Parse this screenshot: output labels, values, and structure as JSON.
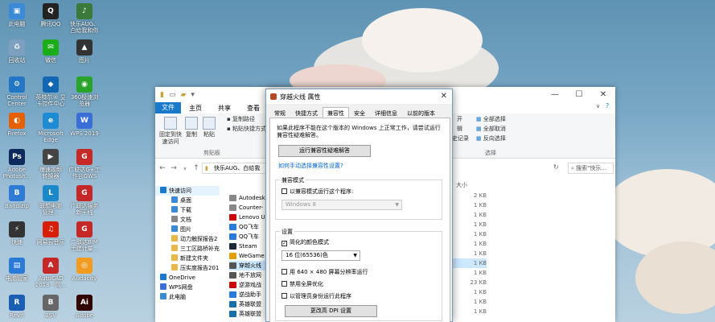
{
  "desktop": {
    "icons": [
      {
        "label": "此电脑",
        "color": "#3a8ad8",
        "glyph": "▣"
      },
      {
        "label": "腾讯QQ",
        "color": "#222",
        "glyph": "Q"
      },
      {
        "label": "快乐AUG、\n白给我和你",
        "color": "#3b7a3b",
        "glyph": "♪"
      },
      {
        "label": "回收站",
        "color": "#7da0c0",
        "glyph": "♻"
      },
      {
        "label": "微信",
        "color": "#1aad19",
        "glyph": "✉"
      },
      {
        "label": "图片",
        "color": "#333",
        "glyph": "▲"
      },
      {
        "label": "Control\nCenter",
        "color": "#2376c4",
        "glyph": "⚙"
      },
      {
        "label": "英特尔® 显\n卡控件中心",
        "color": "#1167b1",
        "glyph": "◆"
      },
      {
        "label": "360极速浏\n览器",
        "color": "#29a329",
        "glyph": "◉"
      },
      {
        "label": "Firefox",
        "color": "#e66000",
        "glyph": "◐"
      },
      {
        "label": "Microsoft\nEdge",
        "color": "#1e8bd3",
        "glyph": "e"
      },
      {
        "label": "WPS 2019",
        "color": "#3b6fd8",
        "glyph": "W"
      },
      {
        "label": "Adobe\nPhotosh...",
        "color": "#0e2a5c",
        "glyph": "Ps"
      },
      {
        "label": "爆速视频\n转换器",
        "color": "#444",
        "glyph": "▶"
      },
      {
        "label": "广联达G+工\n作台GWS",
        "color": "#c62828",
        "glyph": "G"
      },
      {
        "label": "Bandizip",
        "color": "#2d7bd4",
        "glyph": "B"
      },
      {
        "label": "联想电脑\n管理...",
        "color": "#1a88c9",
        "glyph": "L"
      },
      {
        "label": "广联达服务\n新干线",
        "color": "#c62828",
        "glyph": "G"
      },
      {
        "label": "快速",
        "color": "#333",
        "glyph": "⚡"
      },
      {
        "label": "网易云音乐",
        "color": "#d81e06",
        "glyph": "♫"
      },
      {
        "label": "广联达BIM\n土建计量...",
        "color": "#c62828",
        "glyph": "G"
      },
      {
        "label": "电脑管家",
        "color": "#2a7ad8",
        "glyph": "▤"
      },
      {
        "label": "AutoCAD\n2018 - 简...",
        "color": "#c62828",
        "glyph": "A"
      },
      {
        "label": "Audacity",
        "color": "#f29c1f",
        "glyph": "◎"
      },
      {
        "label": "Revit",
        "color": "#1a5fb4",
        "glyph": "R"
      },
      {
        "label": "BSV",
        "color": "#666",
        "glyph": "B"
      },
      {
        "label": "Adobe",
        "color": "#300",
        "glyph": "Ai"
      }
    ]
  },
  "explorer": {
    "title": "",
    "window_controls": [
      "—",
      "☐",
      "✕"
    ],
    "menu_tabs": [
      "文件",
      "主页",
      "共享",
      "查看"
    ],
    "ribbon": {
      "pin_label": "固定到快\n速访问",
      "copy_label": "复制",
      "paste_label": "粘贴",
      "copy_path": "复制路径",
      "paste_shortcut": "粘贴快捷方式",
      "cut": "剪切",
      "clipboard_group": "剪贴板",
      "select_all": "全部选择",
      "select_none": "全部取消",
      "invert": "反向选择",
      "select_group": "选择",
      "open_label": "开",
      "edit_label": "辑",
      "history_label": "历史记录",
      "help_label": "?"
    },
    "address": {
      "path": "快乐AUG、白给我",
      "search_placeholder": "搜索\"快乐...",
      "nav": [
        "←",
        "→",
        "∨",
        "↑"
      ]
    },
    "nav_pane": [
      {
        "label": "快速访问",
        "color": "#1979ca"
      },
      {
        "label": "桌面",
        "color": "#3a8ad8"
      },
      {
        "label": "下载",
        "color": "#3a8ad8"
      },
      {
        "label": "文档",
        "color": "#888"
      },
      {
        "label": "图片",
        "color": "#3a8ad8"
      },
      {
        "label": "动力触探报告2",
        "color": "#e8b84a"
      },
      {
        "label": "三工区路桥补充",
        "color": "#e8b84a"
      },
      {
        "label": "新建文件夹",
        "color": "#e8b84a"
      },
      {
        "label": "压实度报告201",
        "color": "#e8b84a"
      },
      {
        "label": "OneDrive",
        "color": "#1979ca"
      },
      {
        "label": "WPS网盘",
        "color": "#3b6fd8"
      },
      {
        "label": "此电脑",
        "color": "#3a8ad8"
      }
    ],
    "files": [
      {
        "label": "Autodesk",
        "color": "#888"
      },
      {
        "label": "Counter-",
        "color": "#888"
      },
      {
        "label": "Lenovo U",
        "color": "#c00"
      },
      {
        "label": "QQ飞车",
        "color": "#2a7ad8"
      },
      {
        "label": "QQ飞车",
        "color": "#2a7ad8"
      },
      {
        "label": "Steam",
        "color": "#1b2838"
      },
      {
        "label": "WeGame",
        "color": "#e0a000"
      },
      {
        "label": "穿越火线",
        "color": "#555"
      },
      {
        "label": "地不放网",
        "color": "#555"
      },
      {
        "label": "逆游戏战",
        "color": "#c00"
      },
      {
        "label": "逆战助手",
        "color": "#2a7ad8"
      },
      {
        "label": "英雄联盟",
        "color": "#1b6fa8"
      },
      {
        "label": "英雄联盟",
        "color": "#1b6fa8"
      }
    ],
    "size_header": "大小",
    "sizes": [
      "2 KB",
      "1 KB",
      "1 KB",
      "1 KB",
      "1 KB",
      "1 KB",
      "1 KB",
      "1 KB",
      "1 KB",
      "23 KB",
      "1 KB",
      "1 KB",
      "1 KB"
    ]
  },
  "dialog": {
    "title": "穿越火线 属性",
    "close": "✕",
    "tabs": [
      "常规",
      "快捷方式",
      "兼容性",
      "安全",
      "详细信息",
      "以前的版本"
    ],
    "active_tab": "兼容性",
    "intro": "如果此程序不能在这个版本的 Windows 上正常工作，请尝试运行兼容性疑难解答。",
    "troubleshoot_button": "运行兼容性疑难解答",
    "manual_link": "如何手动选择兼容性设置?",
    "compat_mode_group": "兼容模式",
    "compat_checkbox": "以兼容模式运行这个程序:",
    "compat_os": "Windows 8",
    "settings_group": "设置",
    "reduced_color": "简化的颜色模式",
    "color_option": "16 位(65536)色",
    "res640": "用 640 × 480 屏幕分辨率运行",
    "disable_fullscreen": "禁用全屏优化",
    "run_as_admin": "以管理员身份运行此程序",
    "dpi_button": "更改高 DPI 设置"
  }
}
